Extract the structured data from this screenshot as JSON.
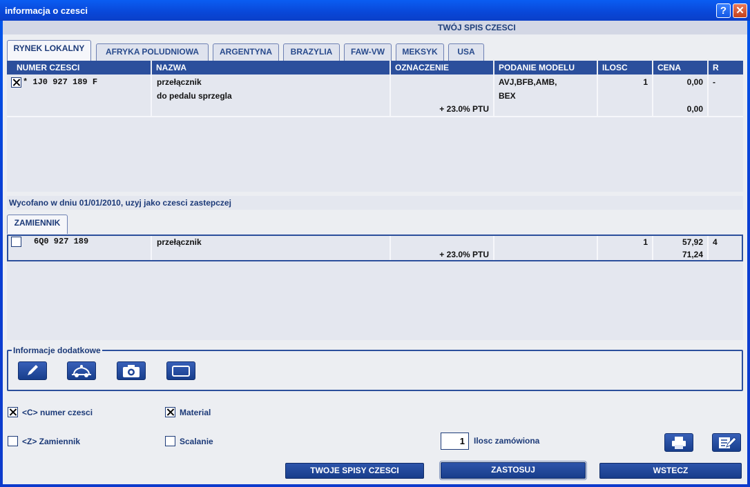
{
  "window": {
    "title": "informacja o czesci",
    "help_glyph": "?",
    "close_glyph": "✕"
  },
  "header": {
    "title": "TWÓJ SPIS CZESCI"
  },
  "tabs": [
    {
      "label": "RYNEK LOKALNY",
      "active": true
    },
    {
      "label": "AFRYKA POLUDNIOWA"
    },
    {
      "label": "ARGENTYNA"
    },
    {
      "label": "BRAZYLIA"
    },
    {
      "label": "FAW-VW"
    },
    {
      "label": "MEKSYK"
    },
    {
      "label": "USA"
    }
  ],
  "columns": [
    "NUMER CZESCI",
    "NAZWA",
    "OZNACZENIE",
    "PODANIE MODELU",
    "ILOSC",
    "CENA",
    "R"
  ],
  "main_row": {
    "checked": true,
    "part_number": "* 1J0 927 189 F",
    "name_line1": "przełącznik",
    "name_line2": "do pedalu sprzegla",
    "tax": "+ 23.0% PTU",
    "model_line1": "AVJ,BFB,AMB,",
    "model_line2": "BEX",
    "qty": "1",
    "price": "0,00",
    "price_gross": "0,00",
    "r": "-"
  },
  "withdrawn_notice": "Wycofano w dniu 01/01/2010, uzyj jako czesci zastepczej",
  "replacement_tab": "ZAMIENNIK",
  "replacement_row": {
    "checked": false,
    "part_number": "6Q0 927 189",
    "name": "przełącznik",
    "tax": "+ 23.0% PTU",
    "qty": "1",
    "price": "57,92",
    "price_gross": "71,24",
    "r": "4"
  },
  "info_section": {
    "label": "Informacje dodatkowe"
  },
  "options": {
    "part_number_label": "<C> numer czesci",
    "part_number_checked": true,
    "material_label": "Material",
    "material_checked": true,
    "replacement_label": "<Z> Zamiennik",
    "replacement_checked": false,
    "merge_label": "Scalanie",
    "merge_checked": false
  },
  "order": {
    "qty": "1",
    "qty_label": "Ilosc zamówiona"
  },
  "buttons": {
    "lists": "TWOJE SPISY CZESCI",
    "apply": "ZASTOSUJ",
    "back": "WSTECZ"
  },
  "colors": {
    "accent": "#2b4f9c",
    "title_bar": "#0a47d8",
    "text": "#1c3a78"
  }
}
